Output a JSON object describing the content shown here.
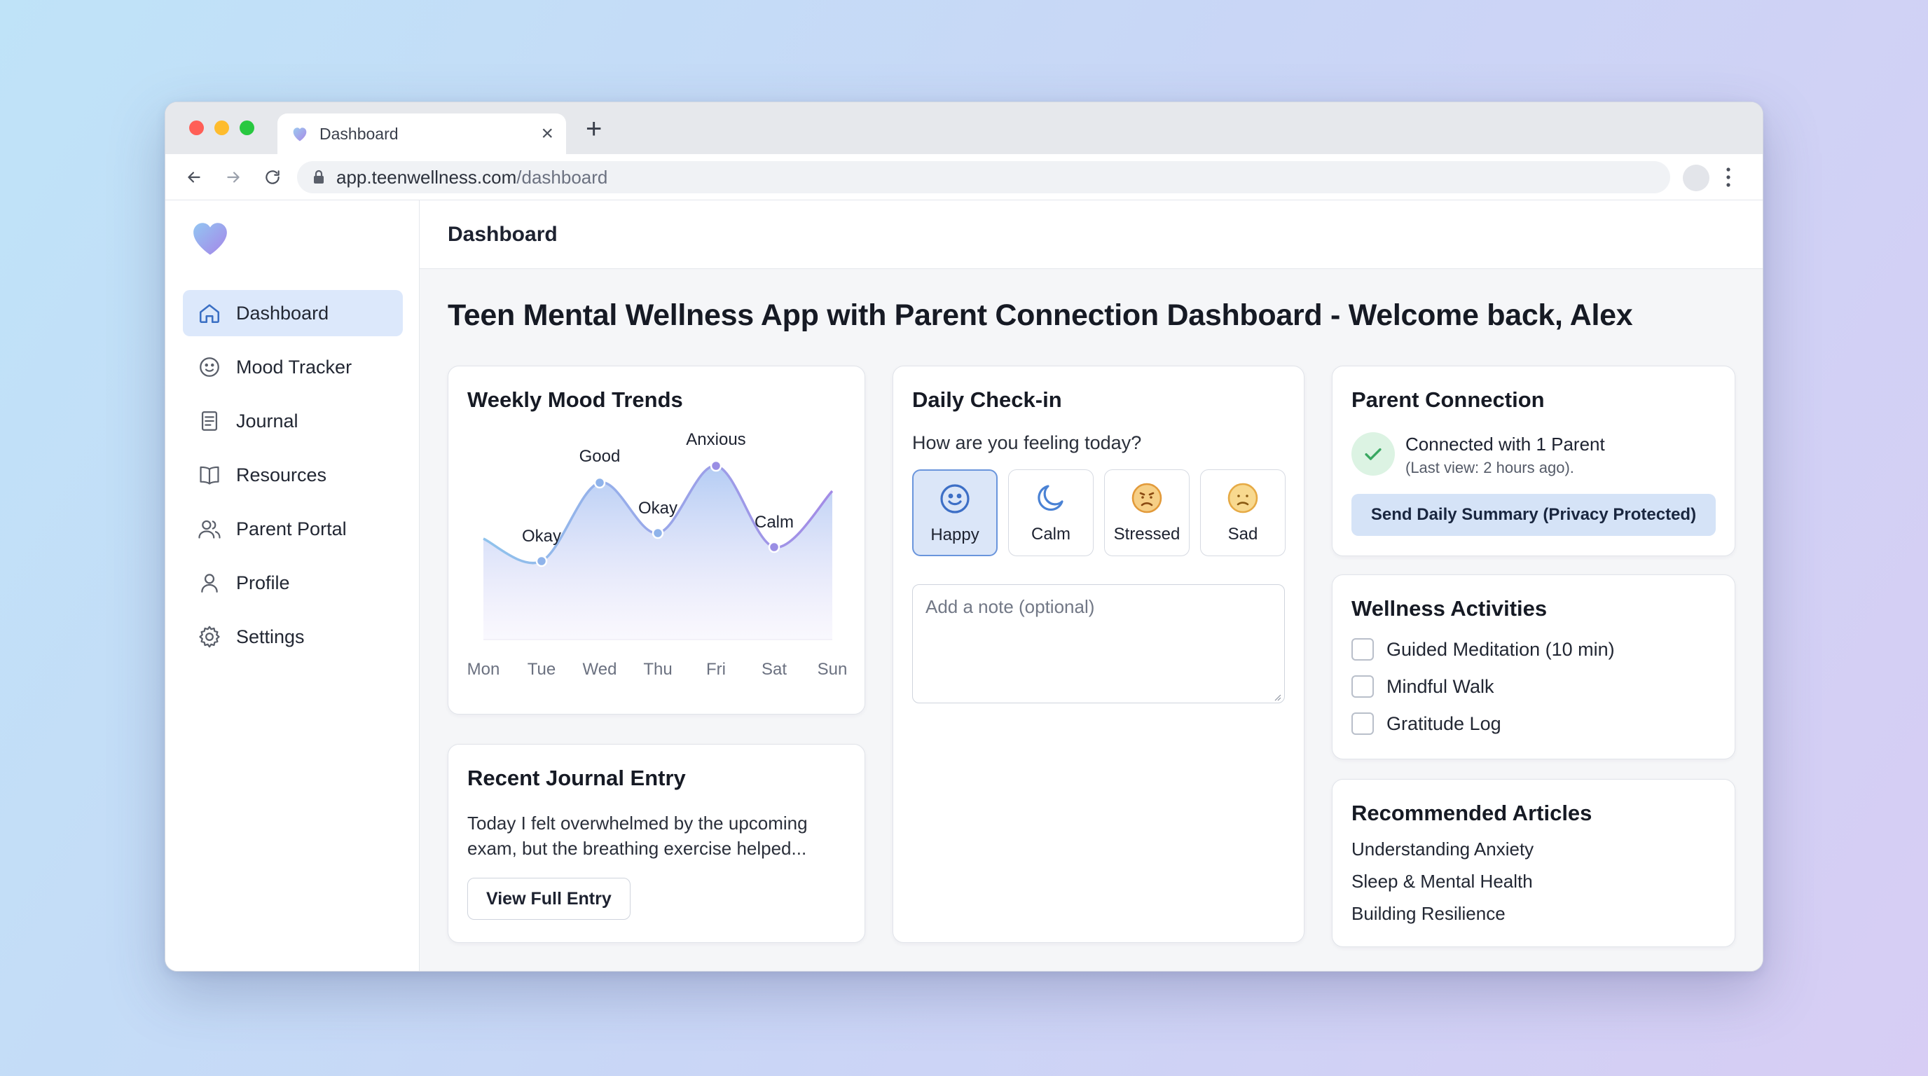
{
  "browser": {
    "tab_title": "Dashboard",
    "url_domain": "app.teenwellness.com",
    "url_path": "/dashboard"
  },
  "sidebar": {
    "items": [
      {
        "label": "Dashboard",
        "icon": "home-icon",
        "active": true
      },
      {
        "label": "Mood Tracker",
        "icon": "smiley-icon"
      },
      {
        "label": "Journal",
        "icon": "journal-icon"
      },
      {
        "label": "Resources",
        "icon": "book-icon"
      },
      {
        "label": "Parent Portal",
        "icon": "users-icon"
      },
      {
        "label": "Profile",
        "icon": "user-icon"
      },
      {
        "label": "Settings",
        "icon": "gear-icon"
      }
    ]
  },
  "header": {
    "title": "Dashboard"
  },
  "welcome": "Teen Mental Wellness App with Parent Connection Dashboard - Welcome back, Alex",
  "mood_card": {
    "title": "Weekly Mood Trends"
  },
  "chart_data": {
    "type": "area",
    "categories": [
      "Mon",
      "Tue",
      "Wed",
      "Thu",
      "Fri",
      "Sat",
      "Sun"
    ],
    "point_labels": [
      "",
      "Okay",
      "Good",
      "Okay",
      "Anxious",
      "Calm",
      ""
    ],
    "values": [
      3.6,
      2.8,
      5.6,
      3.8,
      6.2,
      3.3,
      5.3
    ],
    "ylim": [
      0,
      7
    ],
    "title": "",
    "xlabel": "",
    "ylabel": "",
    "grid": false
  },
  "journal": {
    "title": "Recent Journal Entry",
    "text": "Today I felt overwhelmed by the upcoming exam, but the breathing exercise helped...",
    "button": "View Full Entry"
  },
  "checkin": {
    "title": "Daily Check-in",
    "question": "How are you feeling today?",
    "options": [
      {
        "label": "Happy",
        "icon": "happy-face-icon",
        "selected": true
      },
      {
        "label": "Calm",
        "icon": "moon-icon"
      },
      {
        "label": "Stressed",
        "icon": "stressed-face-icon"
      },
      {
        "label": "Sad",
        "icon": "sad-face-icon"
      }
    ],
    "note_placeholder": "Add a note (optional)"
  },
  "parent": {
    "title": "Parent Connection",
    "status": "Connected with 1 Parent",
    "last_view": "(Last view: 2 hours ago).",
    "button": "Send Daily Summary (Privacy Protected)"
  },
  "wellness": {
    "title": "Wellness Activities",
    "items": [
      "Guided Meditation (10 min)",
      "Mindful Walk",
      "Gratitude Log"
    ]
  },
  "articles": {
    "title": "Recommended Articles",
    "items": [
      "Understanding Anxiety",
      "Sleep & Mental Health",
      "Building Resilience"
    ]
  },
  "colors": {
    "accent": "#6a95dc",
    "active_nav": "#dce8fb",
    "line_start": "#8fc3ec",
    "line_end": "#a38be6",
    "success": "#3aa862",
    "warn": "#e9a43c"
  }
}
